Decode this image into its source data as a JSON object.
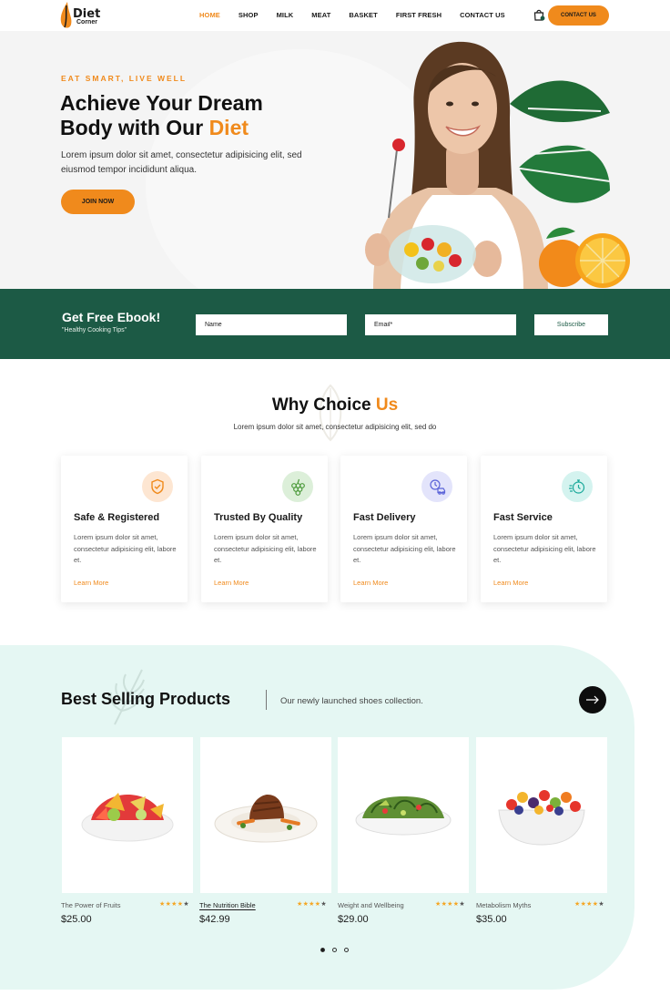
{
  "brand": {
    "logo_line1": "Diet",
    "logo_line2": "Corner"
  },
  "nav": {
    "items": [
      "HOME",
      "SHOP",
      "MILK",
      "MEAT",
      "BASKET",
      "FIRST FRESH",
      "CONTACT US"
    ],
    "active": "HOME",
    "cta": "CONTACT US"
  },
  "hero": {
    "eyebrow": "EAT SMART, LIVE WELL",
    "title_line1": "Achieve Your Dream",
    "title_line2_prefix": "Body with Our ",
    "title_accent": "Diet",
    "text": "Lorem ipsum dolor sit amet, consectetur adipisicing elit, sed eiusmod tempor incididunt aliqua.",
    "button": "JOIN NOW"
  },
  "ebook": {
    "title": "Get Free Ebook!",
    "subtitle": "\"Healthy Cooking Tips\"",
    "name_placeholder": "Name",
    "email_placeholder": "Email*",
    "button": "Subscribe"
  },
  "why": {
    "title_prefix": "Why Choice ",
    "title_accent": "Us",
    "subtitle": "Lorem ipsum dolor sit amet, consectetur adipisicing elit, sed do",
    "cards": [
      {
        "title": "Safe & Registered",
        "text": "Lorem ipsum dolor sit amet, consectetur adipisicing elit, labore et.",
        "link": "Learn More",
        "icon": "shield-check-icon",
        "icon_bg": "#fde6d2",
        "icon_color": "#f08a1c"
      },
      {
        "title": "Trusted By Quality",
        "text": "Lorem ipsum dolor sit amet, consectetur adipisicing elit, labore et.",
        "link": "Learn More",
        "icon": "grapes-icon",
        "icon_bg": "#dcefd9",
        "icon_color": "#4c9a3b"
      },
      {
        "title": "Fast Delivery",
        "text": "Lorem ipsum dolor sit amet, consectetur adipisicing elit, labore et.",
        "link": "Learn More",
        "icon": "delivery-truck-icon",
        "icon_bg": "#e3e4fb",
        "icon_color": "#5a63d8"
      },
      {
        "title": "Fast Service",
        "text": "Lorem ipsum dolor sit amet, consectetur adipisicing elit, labore et.",
        "link": "Learn More",
        "icon": "stopwatch-icon",
        "icon_bg": "#d4f3ef",
        "icon_color": "#1aa99a"
      }
    ]
  },
  "best": {
    "title": "Best Selling Products",
    "subtitle": "Our newly launched shoes collection.",
    "products": [
      {
        "name": "The Power of Fruits",
        "price": "$25.00",
        "rating": 4,
        "image": "fruit-salad-image"
      },
      {
        "name": "The Nutrition Bible",
        "price": "$42.99",
        "rating": 4,
        "image": "steak-plate-image"
      },
      {
        "name": "Weight and Wellbeing",
        "price": "$29.00",
        "rating": 4,
        "image": "green-salad-image"
      },
      {
        "name": "Metabolism Myths",
        "price": "$35.00",
        "rating": 4,
        "image": "berry-bowl-image"
      }
    ],
    "pagination": {
      "pages": 3,
      "current": 1
    }
  },
  "colors": {
    "accent": "#f08a1c",
    "band": "#1c5a45",
    "mint": "#e5f7f3"
  }
}
